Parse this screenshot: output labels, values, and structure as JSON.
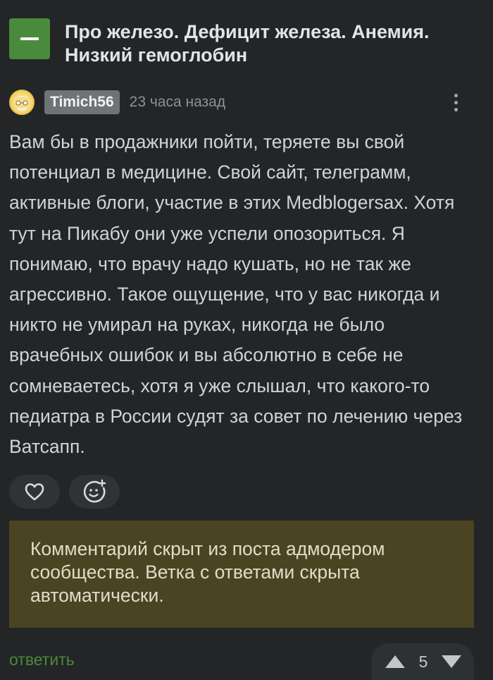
{
  "post": {
    "title": "Про железо. Дефицит железа. Анемия. Низкий гемоглобин"
  },
  "comment": {
    "username": "Timich56",
    "timestamp": "23 часа назад",
    "text": "Вам бы в продажники пойти, теряете вы свой потенциал в медицине. Свой сайт, телеграмм, активные блоги, участие в этих Medblogersах. Хотя тут на Пикабу они уже успели опозориться. Я понимаю, что врачу надо кушать, но не так же агрессивно. Такое ощущение, что у вас никогда и никто не умирал на руках, никогда не было врачебных ошибок и вы абсолютно в себе не сомневаетесь, хотя я уже слышал, что какого-то педиатра в России судят за совет по лечению через Ватсапп.",
    "icons": {
      "collapse": "minus-icon",
      "more": "more-vertical-icon",
      "like": "heart-icon",
      "react": "smile-plus-icon",
      "upvote": "triangle-up-icon",
      "downvote": "triangle-down-icon"
    }
  },
  "hidden_notice": {
    "text": "Комментарий скрыт из поста адмодером сообщества. Ветка с ответами скрыта автоматически."
  },
  "actions": {
    "reply_label": "ответить",
    "rating": "5"
  },
  "colors": {
    "background": "#232526",
    "accent_green": "#4a8a3c",
    "notice_background": "#4a4422",
    "username_badge": "#6f7377"
  }
}
